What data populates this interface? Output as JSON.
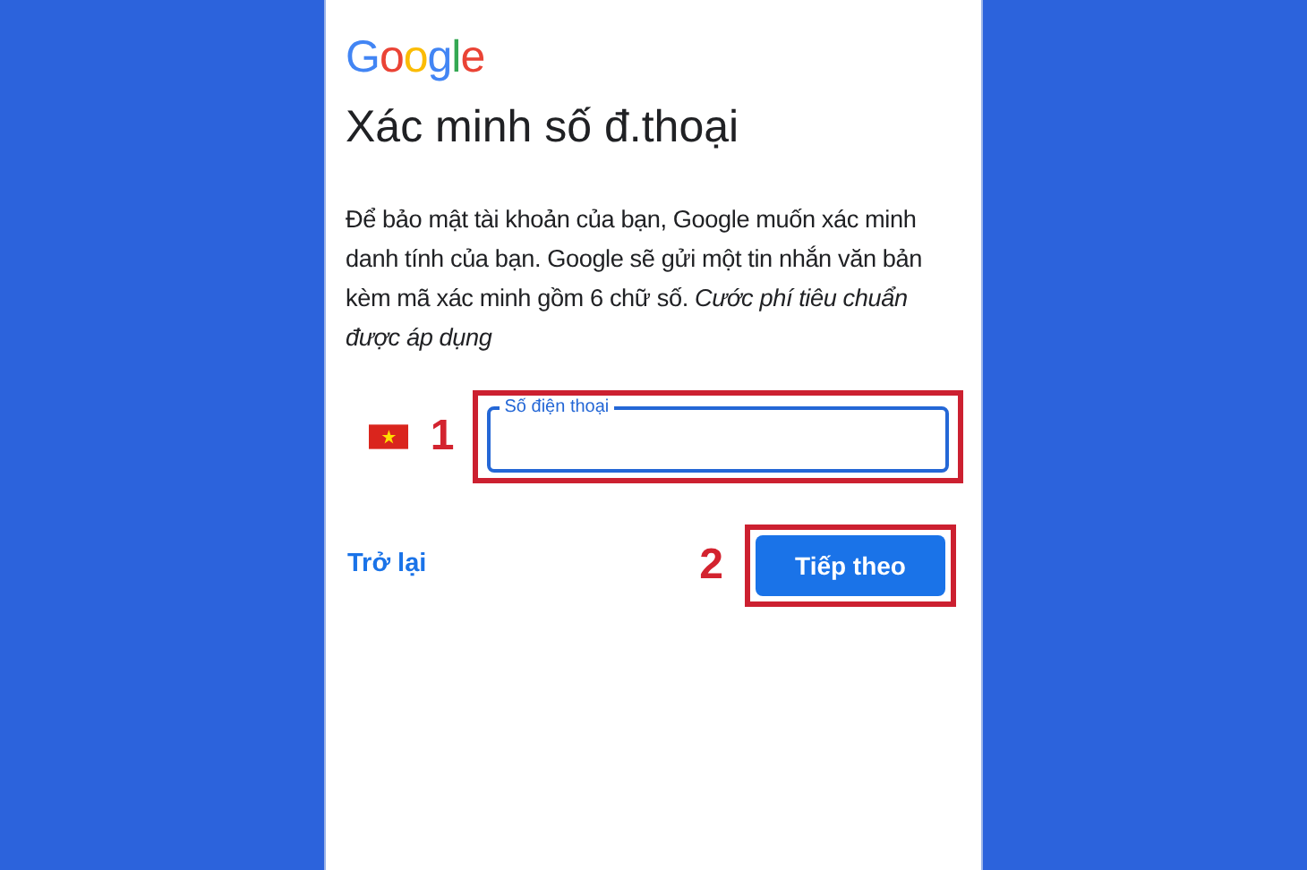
{
  "logo": "Google",
  "title": "Xác minh số đ.thoại",
  "description": "Để bảo mật tài khoản của bạn, Google muốn xác minh danh tính của bạn. Google sẽ gửi một tin nhắn văn bản kèm mã xác minh gồm 6 chữ số. *Cước phí tiêu chuẩn được áp dụng*",
  "phone_field": {
    "label": "Số điện thoại",
    "step": "1"
  },
  "back_link": "Trở lại",
  "next_button": {
    "label": "Tiếp theo",
    "step": "2"
  }
}
